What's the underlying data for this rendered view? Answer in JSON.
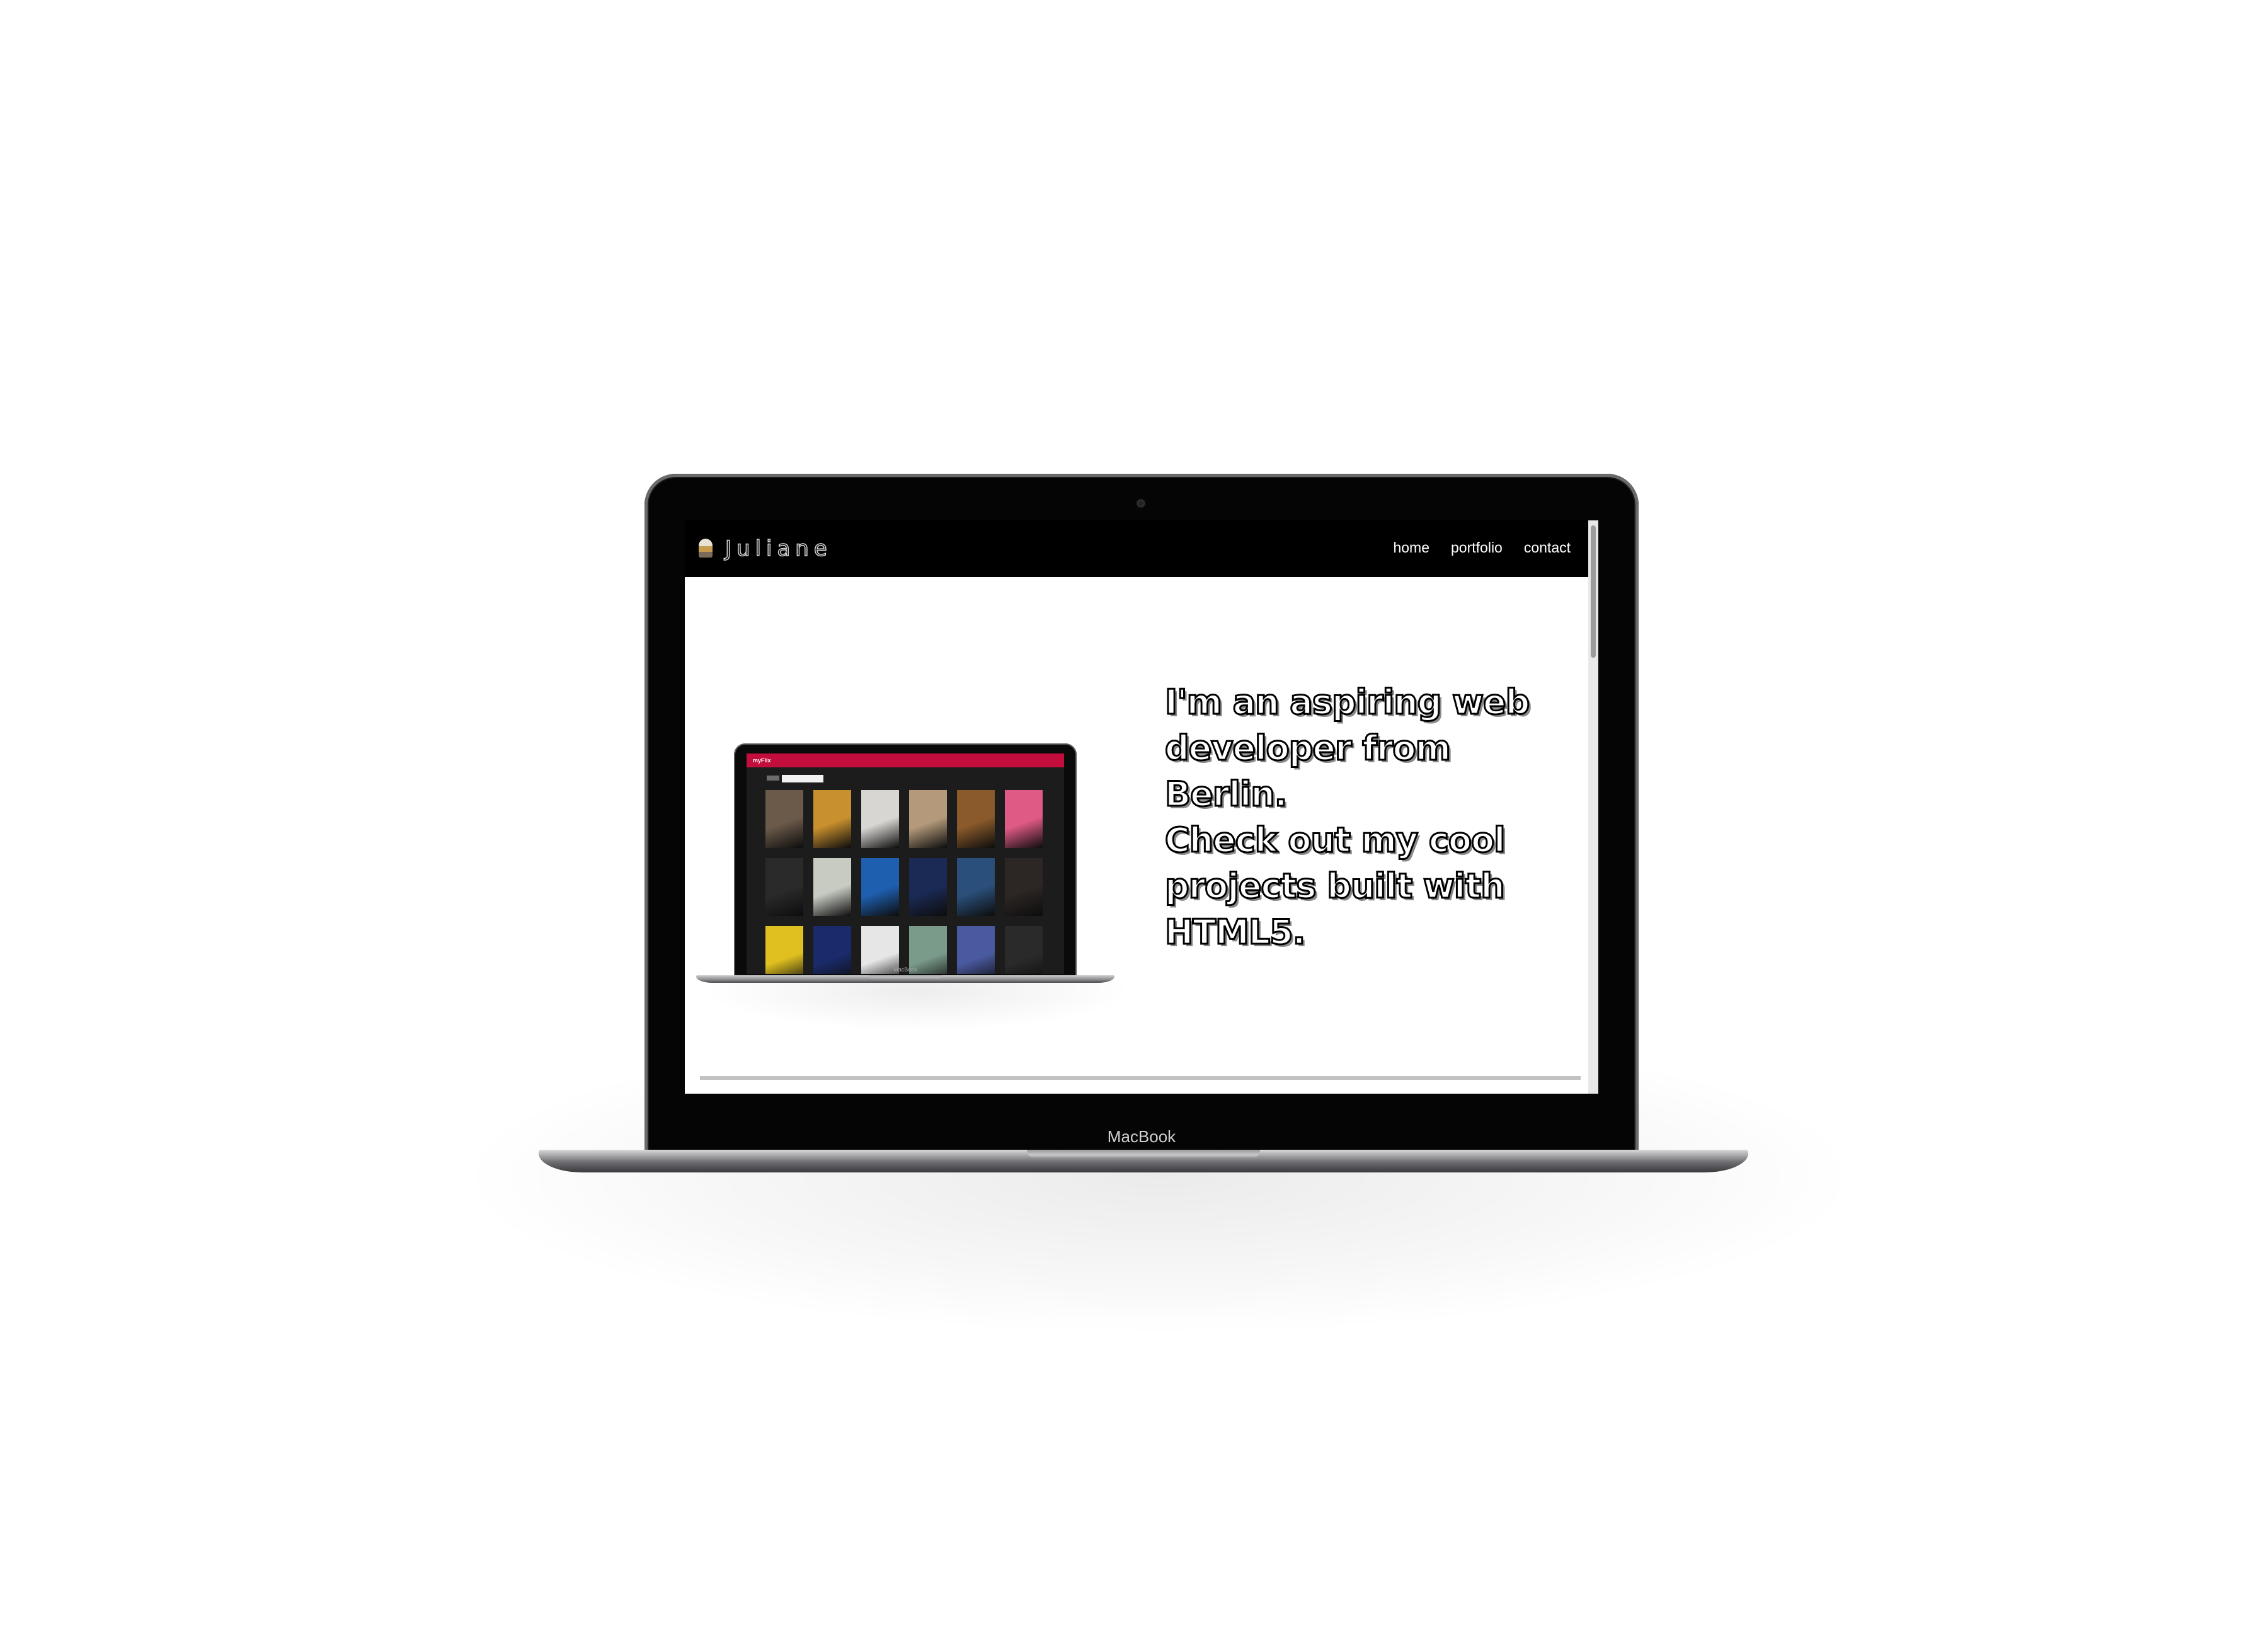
{
  "device": {
    "label": "MacBook"
  },
  "site": {
    "logo_text": "Juliane",
    "nav": [
      {
        "label": "home"
      },
      {
        "label": "portfolio"
      },
      {
        "label": "contact"
      }
    ],
    "hero_lines": [
      "I'm an aspiring web",
      "developer from",
      "Berlin.",
      "Check out my cool",
      "projects built with",
      "HTML5."
    ],
    "preview": {
      "brand": "myFlix",
      "device_label": "MacBook",
      "poster_colors": [
        "#6b5a4a",
        "#c9902e",
        "#d8d6d2",
        "#b49a7a",
        "#8a5a2a",
        "#e05a86",
        "#2a2a2a",
        "#c8cbc2",
        "#1e5fb0",
        "#1b2a55",
        "#2a4f7a",
        "#2c2624",
        "#e0c020",
        "#1a2a6a",
        "#e6e6e6",
        "#7a9a8a",
        "#4a5aa0",
        "#2a2a2a"
      ]
    }
  }
}
